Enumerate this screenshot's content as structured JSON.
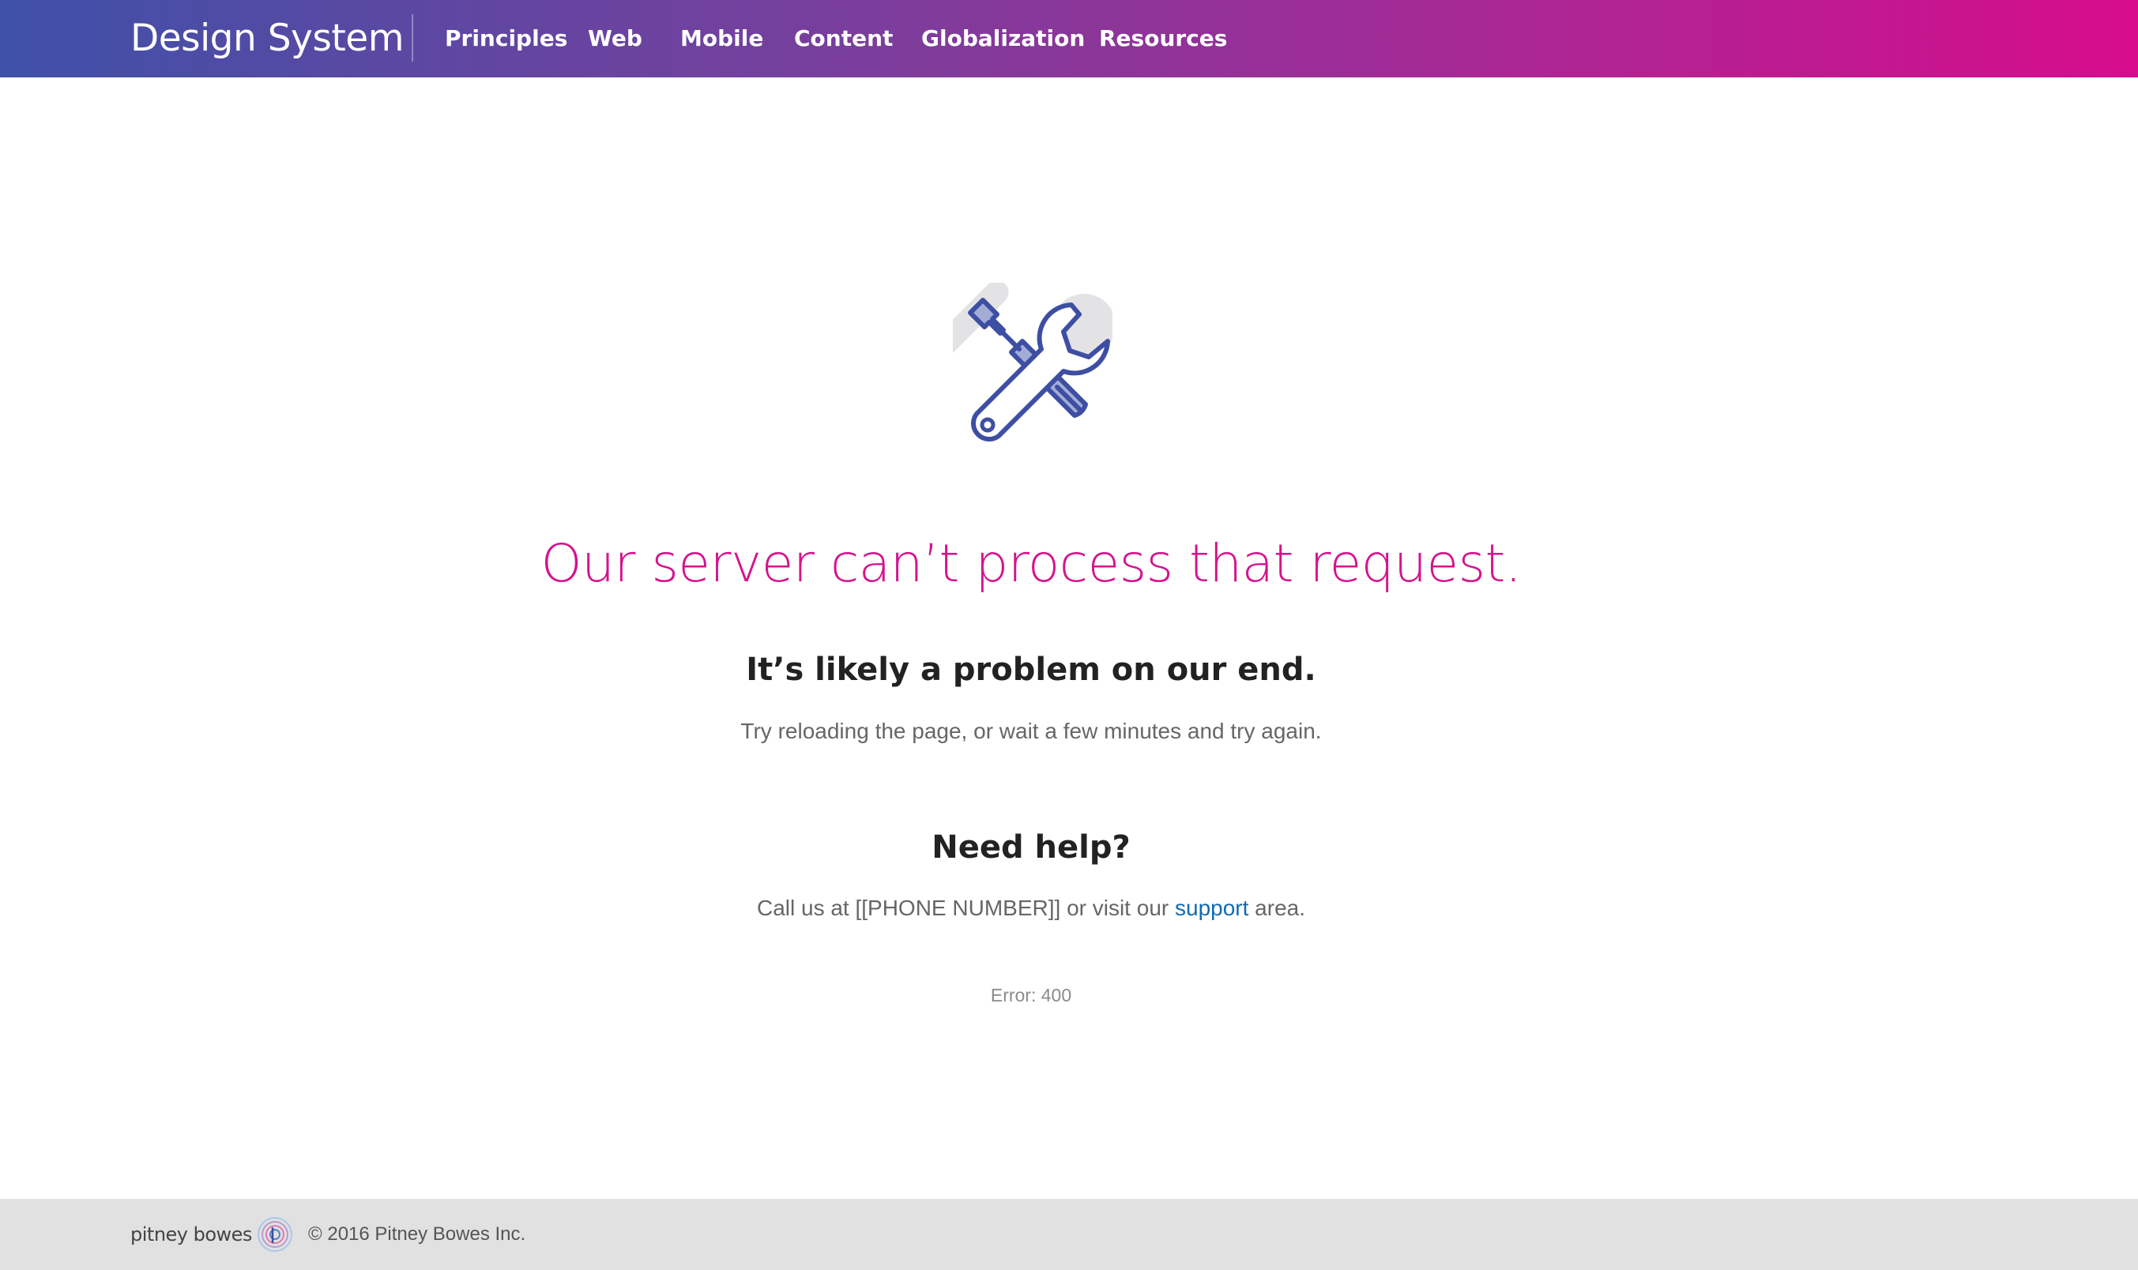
{
  "header": {
    "brand": "Design System",
    "nav": [
      {
        "label": "Principles"
      },
      {
        "label": "Web"
      },
      {
        "label": "Mobile"
      },
      {
        "label": "Content"
      },
      {
        "label": "Globalization"
      },
      {
        "label": "Resources"
      }
    ],
    "gradient_start": "#3f51a8",
    "gradient_end": "#d60c8c"
  },
  "main": {
    "icon": "wrench-screwdriver-icon",
    "headline": "Our server can’t process that request.",
    "subhead": "It’s likely a problem on our end.",
    "body": "Try reloading the page, or wait a few minutes and try again.",
    "help_title": "Need help?",
    "help_prefix": "Call us at [[PHONE NUMBER]] or visit our ",
    "help_link": "support",
    "help_suffix": " area.",
    "error": "Error: 400",
    "accent_color": "#d4138f",
    "link_color": "#0f6bb4"
  },
  "footer": {
    "logo_text": "pitney bowes",
    "copyright": "© 2016 Pitney Bowes Inc.",
    "background": "#e1e1e1"
  }
}
